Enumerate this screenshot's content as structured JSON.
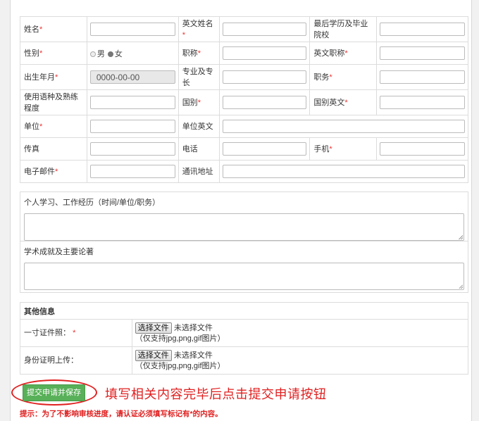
{
  "form": {
    "rows": [
      [
        {
          "label": "姓名",
          "req": true,
          "type": "text"
        },
        {
          "label": "英文姓名",
          "req": true,
          "type": "text"
        },
        {
          "label": "最后学历及毕业院校",
          "req": false,
          "type": "text"
        }
      ],
      [
        {
          "label": "性别",
          "req": true,
          "type": "radio",
          "options": [
            "男",
            "女"
          ],
          "selected": "女"
        },
        {
          "label": "职称",
          "req": true,
          "type": "text"
        },
        {
          "label": "英文职称",
          "req": true,
          "type": "text"
        }
      ],
      [
        {
          "label": "出生年月",
          "req": true,
          "type": "date",
          "value": "0000-00-00"
        },
        {
          "label": "专业及专长",
          "req": false,
          "type": "text"
        },
        {
          "label": "职务",
          "req": true,
          "type": "text"
        }
      ],
      [
        {
          "label": "使用语种及熟练程度",
          "req": false,
          "type": "text"
        },
        {
          "label": "国别",
          "req": true,
          "type": "text"
        },
        {
          "label": "国别英文",
          "req": true,
          "type": "text"
        }
      ],
      [
        {
          "label": "单位",
          "req": true,
          "type": "text"
        },
        {
          "label": "单位英文",
          "req": false,
          "type": "wide"
        }
      ],
      [
        {
          "label": "传真",
          "req": false,
          "type": "text"
        },
        {
          "label": "电话",
          "req": false,
          "type": "text"
        },
        {
          "label": "手机",
          "req": true,
          "type": "text"
        }
      ],
      [
        {
          "label": "电子邮件",
          "req": true,
          "type": "text"
        },
        {
          "label": "通讯地址",
          "req": false,
          "type": "wide"
        }
      ]
    ],
    "required_mark": "*"
  },
  "experience": {
    "label": "个人学习、工作经历（时间/单位/职务）"
  },
  "achievements": {
    "label": "学术成就及主要论著"
  },
  "other": {
    "title": "其他信息",
    "photo_label": "一寸证件照：",
    "photo_req": "*",
    "id_label": "身份证明上传：",
    "file_button": "选择文件",
    "no_file": "未选择文件",
    "file_hint": "（仅支持jpg,png,gif图片）"
  },
  "submit": {
    "label": "提交申请并保存"
  },
  "annotation": "填写相关内容完毕后点击提交申请按钮",
  "tip": "提示：为了不影响审核进度，请认证必须填写标记有*的内容。",
  "colors": {
    "required": "#e33333",
    "submit": "#58b058",
    "annotation": "#e02020"
  }
}
